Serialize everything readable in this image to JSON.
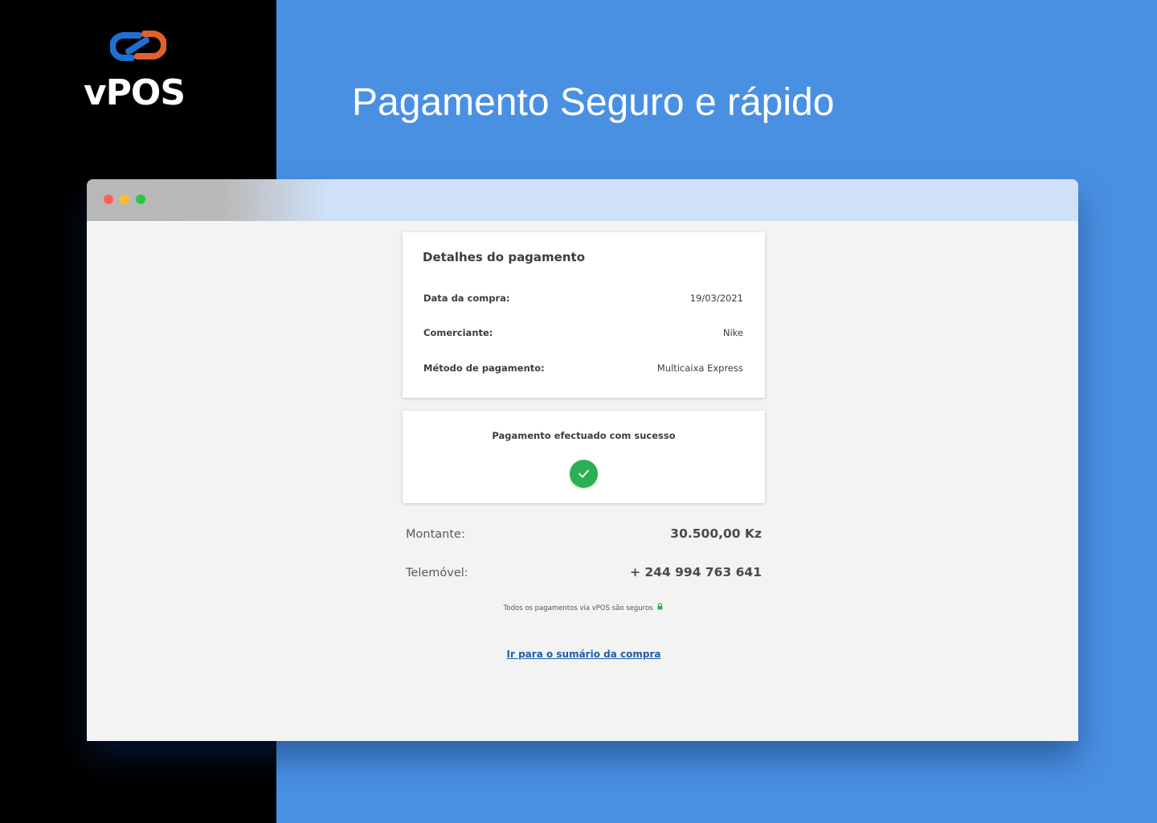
{
  "brand": {
    "name": "vPOS",
    "headline": "Pagamento Seguro e rápido"
  },
  "colors": {
    "background_blue": "#4a90e2",
    "left_panel": "#000000",
    "logo_blue": "#1f6fd0",
    "logo_orange": "#e0622a",
    "success_green": "#2bb051",
    "link_blue": "#1f5fa8"
  },
  "window": {
    "controls": [
      "close",
      "minimize",
      "maximize"
    ]
  },
  "details_card": {
    "title": "Detalhes do pagamento",
    "rows": [
      {
        "label": "Data da compra:",
        "value": "19/03/2021"
      },
      {
        "label": "Comerciante:",
        "value": "Nike"
      },
      {
        "label": "Método de pagamento:",
        "value": "Multicaixa Express"
      }
    ]
  },
  "status_card": {
    "message": "Pagamento efectuado com sucesso",
    "icon": "check-circle-icon"
  },
  "summary": {
    "amount_label": "Montante:",
    "amount_value": "30.500,00 Kz",
    "phone_label": "Telemóvel:",
    "phone_value": "+ 244 994 763 641"
  },
  "security_note": "Todos os pagamentos via vPOS são seguros",
  "purchase_summary_link": "Ir para o sumário da compra"
}
